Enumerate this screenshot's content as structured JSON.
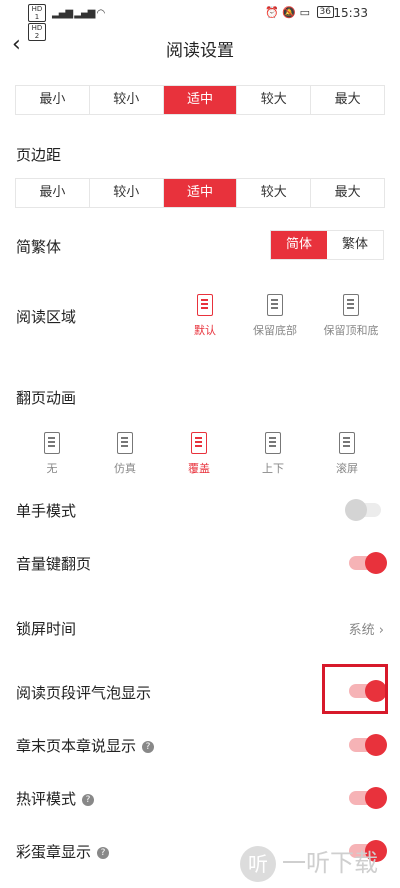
{
  "status": {
    "time": "15:33",
    "hd1": "HD 1",
    "hd2": "HD 2",
    "battery": "36"
  },
  "header": {
    "title": "阅读设置"
  },
  "font_size": {
    "options": [
      "最小",
      "较小",
      "适中",
      "较大",
      "最大"
    ],
    "selected": "适中"
  },
  "margin": {
    "label": "页边距",
    "options": [
      "最小",
      "较小",
      "适中",
      "较大",
      "最大"
    ],
    "selected": "适中"
  },
  "script": {
    "label": "简繁体",
    "options": [
      "简体",
      "繁体"
    ],
    "selected": "简体"
  },
  "reading_area": {
    "label": "阅读区域",
    "options": [
      "默认",
      "保留底部",
      "保留顶和底"
    ],
    "selected": "默认"
  },
  "page_anim": {
    "label": "翻页动画",
    "options": [
      "无",
      "仿真",
      "覆盖",
      "上下",
      "滚屏"
    ],
    "selected": "覆盖"
  },
  "settings": {
    "one_hand": {
      "label": "单手模式",
      "on": false
    },
    "volume_key": {
      "label": "音量键翻页",
      "on": true
    },
    "lock_time": {
      "label": "锁屏时间",
      "value": "系统"
    },
    "bubble": {
      "label": "阅读页段评气泡显示",
      "on": true
    },
    "chapter_end": {
      "label": "章末页本章说显示",
      "on": true
    },
    "hot_comment": {
      "label": "热评模式",
      "on": true
    },
    "easter_egg": {
      "label": "彩蛋章显示",
      "on": true
    }
  },
  "watermark": {
    "logo": "听",
    "text": "一听下载"
  },
  "colors": {
    "accent": "#e8323c",
    "highlight_box": "#d7192a"
  }
}
